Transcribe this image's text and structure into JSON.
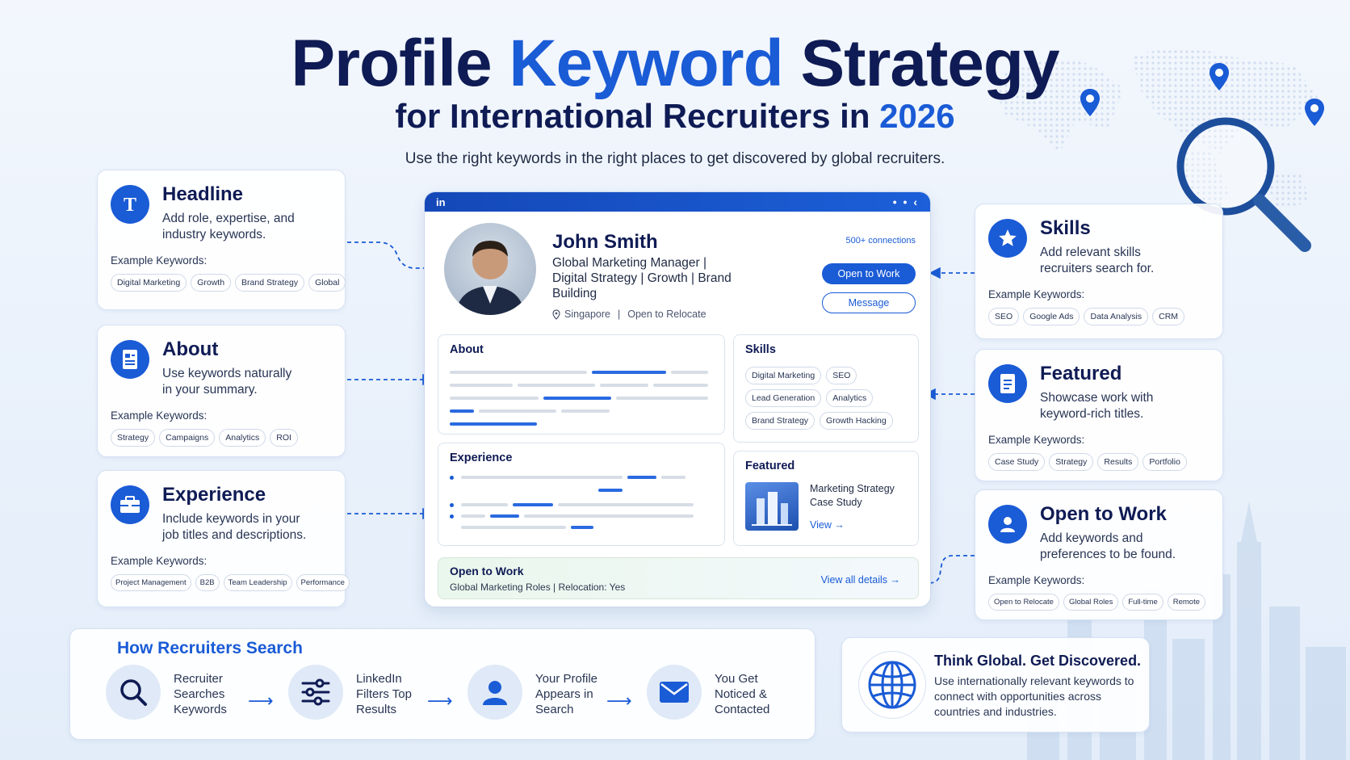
{
  "title": {
    "part1": "Profile ",
    "keyword": "Keyword",
    "part2": " Strategy"
  },
  "subtitle": {
    "text": "for International Recruiters in ",
    "year": "2026"
  },
  "tagline": "Use the right keywords in the right places to get discovered by global recruiters.",
  "example_label": "Example Keywords:",
  "left_cards": [
    {
      "icon": "text-t-icon",
      "title": "Headline",
      "desc_1": "Add role, expertise, and",
      "desc_2": "industry keywords.",
      "keywords": [
        "Digital Marketing",
        "Growth",
        "Brand Strategy",
        "Global"
      ]
    },
    {
      "icon": "document-icon",
      "title": "About",
      "desc_1": "Use keywords naturally",
      "desc_2": "in your summary.",
      "keywords": [
        "Strategy",
        "Campaigns",
        "Analytics",
        "ROI"
      ]
    },
    {
      "icon": "briefcase-icon",
      "title": "Experience",
      "desc_1": "Include keywords in your",
      "desc_2": "job titles and descriptions.",
      "keywords": [
        "Project Management",
        "B2B",
        "Team Leadership",
        "Performance"
      ]
    }
  ],
  "right_cards": [
    {
      "icon": "star-icon",
      "title": "Skills",
      "desc_1": "Add relevant skills",
      "desc_2": "recruiters search for.",
      "keywords": [
        "SEO",
        "Google Ads",
        "Data Analysis",
        "CRM"
      ]
    },
    {
      "icon": "document-icon",
      "title": "Featured",
      "desc_1": "Showcase work with",
      "desc_2": "keyword-rich titles.",
      "keywords": [
        "Case Study",
        "Strategy",
        "Results",
        "Portfolio"
      ]
    },
    {
      "icon": "user-icon",
      "title": "Open to Work",
      "desc_1": "Add keywords and",
      "desc_2": "preferences to be found.",
      "keywords": [
        "Open to Relocate",
        "Global Roles",
        "Full-time",
        "Remote"
      ]
    }
  ],
  "profile": {
    "brand": "in",
    "menu": "• • ‹",
    "name": "John Smith",
    "headline_1": "Global Marketing Manager |",
    "headline_2": "Digital Strategy | Growth | Brand",
    "headline_3": "Building",
    "location": "Singapore",
    "separator": "|",
    "relocate": "Open to Relocate",
    "connections": "500+ connections",
    "open_to_work_button": "Open to Work",
    "message_button": "Message",
    "about_title": "About",
    "experience_title": "Experience",
    "skills_title": "Skills",
    "skills": [
      "Digital Marketing",
      "SEO",
      "Lead Generation",
      "Analytics",
      "Brand Strategy",
      "Growth Hacking"
    ],
    "featured_title": "Featured",
    "featured_item_1": "Marketing Strategy",
    "featured_item_2": "Case Study",
    "featured_view": "View →",
    "open_to_work_title": "Open to Work",
    "open_to_work_sub": "Global Marketing Roles | Relocation: Yes",
    "view_all": "View all details →"
  },
  "how": {
    "title": "How Recruiters Search",
    "steps": [
      {
        "icon": "search-icon",
        "l1": "Recruiter",
        "l2": "Searches",
        "l3": "Keywords"
      },
      {
        "icon": "sliders-icon",
        "l1": "LinkedIn",
        "l2": "Filters Top",
        "l3": "Results"
      },
      {
        "icon": "user-icon",
        "l1": "Your Profile",
        "l2": "Appears in",
        "l3": "Search"
      },
      {
        "icon": "mail-icon",
        "l1": "You Get",
        "l2": "Noticed &",
        "l3": "Contacted"
      }
    ],
    "arrow": "⟶"
  },
  "think": {
    "icon": "globe-icon",
    "title": "Think Global. Get Discovered.",
    "desc": "Use internationally relevant keywords to connect with opportunities across countries and industries."
  },
  "colors": {
    "navy": "#0f1b54",
    "accent": "#1a5bd6",
    "background": "#eef4fc"
  }
}
